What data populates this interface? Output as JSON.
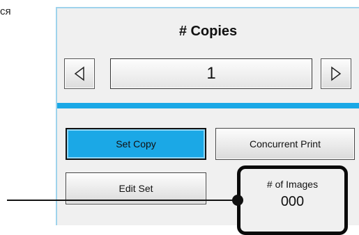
{
  "fragment_text": "ся",
  "copies": {
    "title": "# Copies",
    "value": "1"
  },
  "buttons": {
    "set_copy": "Set Copy",
    "concurrent_print": "Concurrent Print",
    "edit_set": "Edit Set"
  },
  "images": {
    "label": "# of Images",
    "count": "000"
  },
  "icons": {
    "decrement": "triangle-left-icon",
    "increment": "triangle-right-icon"
  },
  "colors": {
    "accent_blue": "#1ba8e6",
    "panel_border": "#9fd3ec",
    "panel_bg": "#f0f0f0"
  }
}
